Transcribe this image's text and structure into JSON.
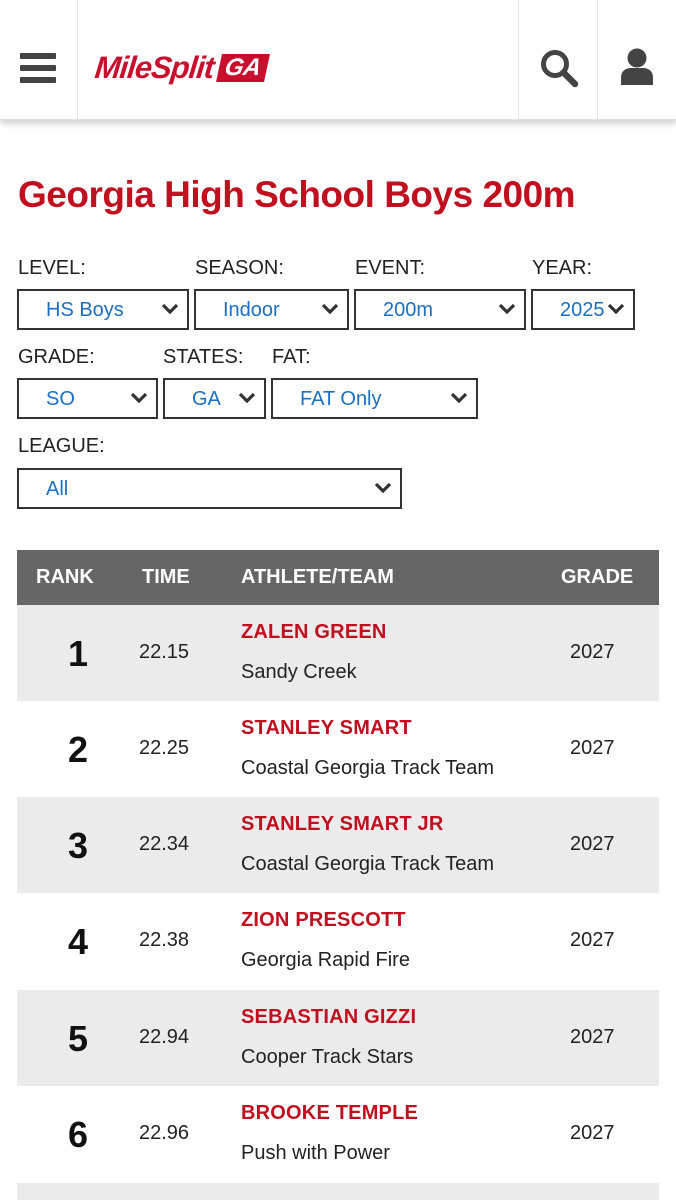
{
  "header": {
    "logo_main": "MileSplit",
    "logo_badge": "GA"
  },
  "page": {
    "title": "Georgia High School Boys 200m"
  },
  "filters": {
    "level": {
      "label": "LEVEL:",
      "value": "HS Boys"
    },
    "season": {
      "label": "SEASON:",
      "value": "Indoor"
    },
    "event": {
      "label": "EVENT:",
      "value": "200m"
    },
    "year": {
      "label": "YEAR:",
      "value": "2025"
    },
    "grade": {
      "label": "GRADE:",
      "value": "SO"
    },
    "states": {
      "label": "STATES:",
      "value": "GA"
    },
    "fat": {
      "label": "FAT:",
      "value": "FAT Only"
    },
    "league": {
      "label": "LEAGUE:",
      "value": "All"
    }
  },
  "table": {
    "headers": {
      "rank": "RANK",
      "time": "TIME",
      "athlete": "ATHLETE/TEAM",
      "grade": "GRADE"
    },
    "rows": [
      {
        "rank": "1",
        "time": "22.15",
        "athlete": "ZALEN GREEN",
        "team": "Sandy Creek",
        "grade": "2027"
      },
      {
        "rank": "2",
        "time": "22.25",
        "athlete": "STANLEY SMART",
        "team": "Coastal Georgia Track Team",
        "grade": "2027"
      },
      {
        "rank": "3",
        "time": "22.34",
        "athlete": "STANLEY SMART JR",
        "team": "Coastal Georgia Track Team",
        "grade": "2027"
      },
      {
        "rank": "4",
        "time": "22.38",
        "athlete": "ZION PRESCOTT",
        "team": "Georgia Rapid Fire",
        "grade": "2027"
      },
      {
        "rank": "5",
        "time": "22.94",
        "athlete": "SEBASTIAN GIZZI",
        "team": "Cooper Track Stars",
        "grade": "2027"
      },
      {
        "rank": "6",
        "time": "22.96",
        "athlete": "BROOKE TEMPLE",
        "team": "Push with Power",
        "grade": "2027"
      }
    ]
  },
  "colors": {
    "brand_red": "#c8102e",
    "title_red": "#c00f1e",
    "link_blue": "#1b6fc4",
    "table_header": "#666666",
    "row_alt": "#ebebeb"
  },
  "icons": {
    "menu": "hamburger-menu-icon",
    "search": "search-icon",
    "user": "user-icon",
    "dropdown": "chevron-down-icon"
  }
}
